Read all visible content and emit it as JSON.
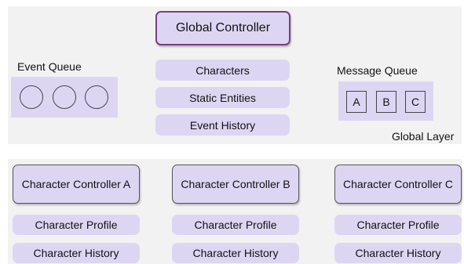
{
  "global_layer": {
    "label": "Global Layer",
    "controller": "Global Controller",
    "event_queue": {
      "label": "Event Queue",
      "items": [
        "",
        "",
        ""
      ]
    },
    "stores": [
      "Characters",
      "Static Entities",
      "Event History"
    ],
    "message_queue": {
      "label": "Message Queue",
      "items": [
        "A",
        "B",
        "C"
      ]
    }
  },
  "character_layer": {
    "columns": [
      {
        "controller": "Character Controller A",
        "profile": "Character Profile",
        "history": "Character History"
      },
      {
        "controller": "Character Controller B",
        "profile": "Character Profile",
        "history": "Character History"
      },
      {
        "controller": "Character Controller C",
        "profile": "Character Profile",
        "history": "Character History"
      }
    ]
  },
  "colors": {
    "panel_bg": "#f2f2f2",
    "node_fill": "#ddd6f3",
    "global_controller_border": "#7a3f80"
  }
}
